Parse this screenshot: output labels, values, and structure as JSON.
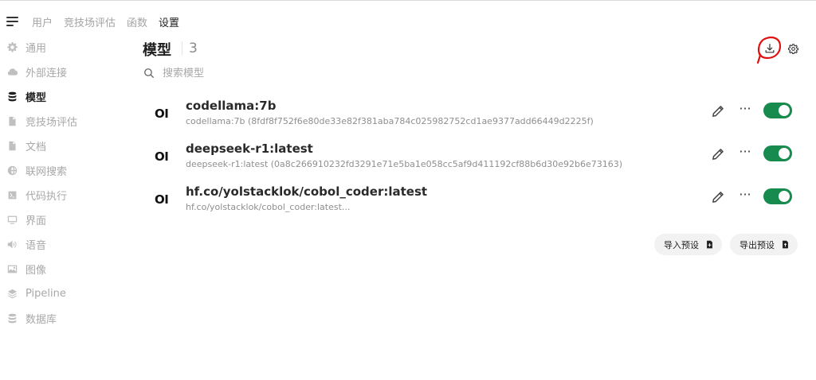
{
  "topnav": {
    "menu_icon": "hamburger-menu-icon",
    "items": [
      {
        "label": "用户",
        "active": false
      },
      {
        "label": "竞技场评估",
        "active": false
      },
      {
        "label": "函数",
        "active": false
      },
      {
        "label": "设置",
        "active": true
      }
    ]
  },
  "sidebar": {
    "items": [
      {
        "label": "通用",
        "icon": "gear-icon",
        "active": false
      },
      {
        "label": "外部连接",
        "icon": "cloud-icon",
        "active": false
      },
      {
        "label": "模型",
        "icon": "database-icon",
        "active": true
      },
      {
        "label": "竞技场评估",
        "icon": "document-icon",
        "active": false
      },
      {
        "label": "文档",
        "icon": "document-icon",
        "active": false
      },
      {
        "label": "联网搜索",
        "icon": "globe-icon",
        "active": false
      },
      {
        "label": "代码执行",
        "icon": "code-terminal-icon",
        "active": false
      },
      {
        "label": "界面",
        "icon": "monitor-icon",
        "active": false
      },
      {
        "label": "语音",
        "icon": "speaker-icon",
        "active": false
      },
      {
        "label": "图像",
        "icon": "image-icon",
        "active": false
      },
      {
        "label": "Pipeline",
        "icon": "layers-icon",
        "active": false
      },
      {
        "label": "数据库",
        "icon": "database-icon",
        "active": false
      }
    ]
  },
  "header": {
    "title": "模型",
    "count": "3",
    "download_icon": "download-icon",
    "settings_icon": "gear-icon"
  },
  "search": {
    "placeholder": "搜索模型",
    "value": ""
  },
  "models": [
    {
      "logo": "OI",
      "name": "codellama:7b",
      "detail": "codellama:7b (8fdf8f752f6e80de33e82f381aba784c025982752cd1ae9377add66449d2225f)",
      "enabled": true
    },
    {
      "logo": "OI",
      "name": "deepseek-r1:latest",
      "detail": "deepseek-r1:latest (0a8c266910232fd3291e71e5ba1e058cc5af9d411192cf88b6d30e92b6e73163)",
      "enabled": true
    },
    {
      "logo": "OI",
      "name": "hf.co/yolstacklok/cobol_coder:latest",
      "detail": "hf.co/yolstacklok/cobol_coder:latest...",
      "enabled": true
    }
  ],
  "actions": {
    "import_label": "导入预设",
    "export_label": "导出预设"
  },
  "colors": {
    "toggle_on": "#178a4e",
    "annotation_red": "#e01010"
  }
}
